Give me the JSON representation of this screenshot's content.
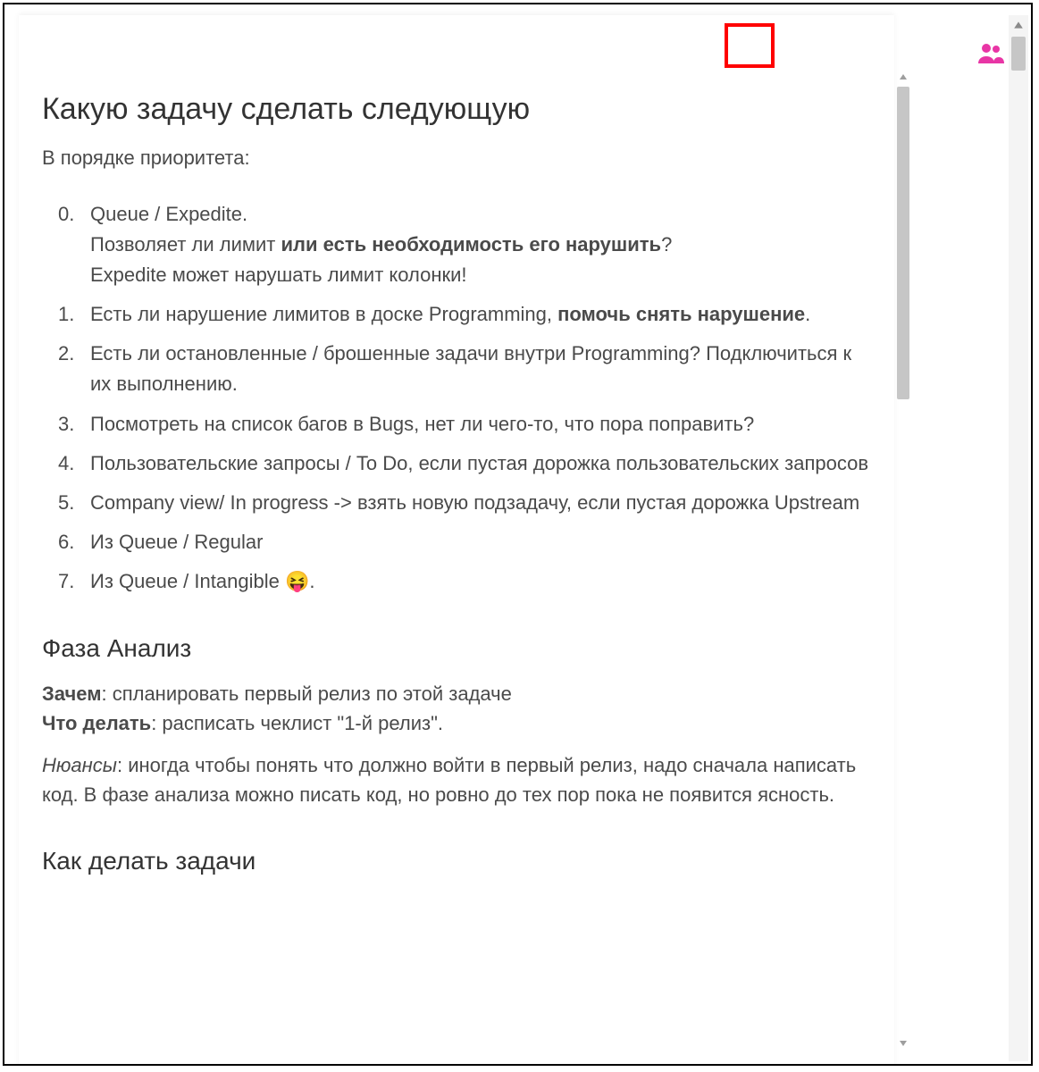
{
  "doc": {
    "h1": "Какую задачу сделать следующую",
    "intro": "В порядке приоритета:",
    "list": [
      {
        "num": "0.",
        "html": "Queue / Expedite.<br>Позволяет ли лимит <span class='bold'>или есть необходимость его нарушить</span>?<br>Expedite может нарушать лимит колонки!"
      },
      {
        "num": "1.",
        "html": "Есть ли нарушение лимитов в доске Programming, <span class='bold'>помочь снять нарушение</span>."
      },
      {
        "num": "2.",
        "html": "Есть ли остановленные / брошенные задачи внутри Programming? Подключиться к их выполнению."
      },
      {
        "num": "3.",
        "html": "Посмотреть на список багов в Bugs, нет ли чего-то, что пора поправить?"
      },
      {
        "num": "4.",
        "html": "Пользовательские запросы / To Do, если пустая дорожка пользовательских запросов"
      },
      {
        "num": "5.",
        "html": "Company view/ In progress -> взять новую подзадачу, если пустая дорожка Upstream"
      },
      {
        "num": "6.",
        "html": "Из Queue / Regular"
      },
      {
        "num": "7.",
        "html": "Из Queue / Intangible <span class='emoji'>😝</span>."
      }
    ],
    "h2_1": "Фаза Анализ",
    "p_zachem_label": "Зачем",
    "p_zachem_text": ": спланировать первый релиз по этой задаче",
    "p_chto_label": "Что делать",
    "p_chto_text": ": расписать чеклист \"1-й релиз\".",
    "p_nuance_label": "Нюансы",
    "p_nuance_text": ": иногда чтобы понять что должно войти в первый релиз, надо сначала написать код. В фазе анализа можно писать код, но ровно до тех пор пока не появится ясность.",
    "h2_2": "Как делать задачи"
  }
}
